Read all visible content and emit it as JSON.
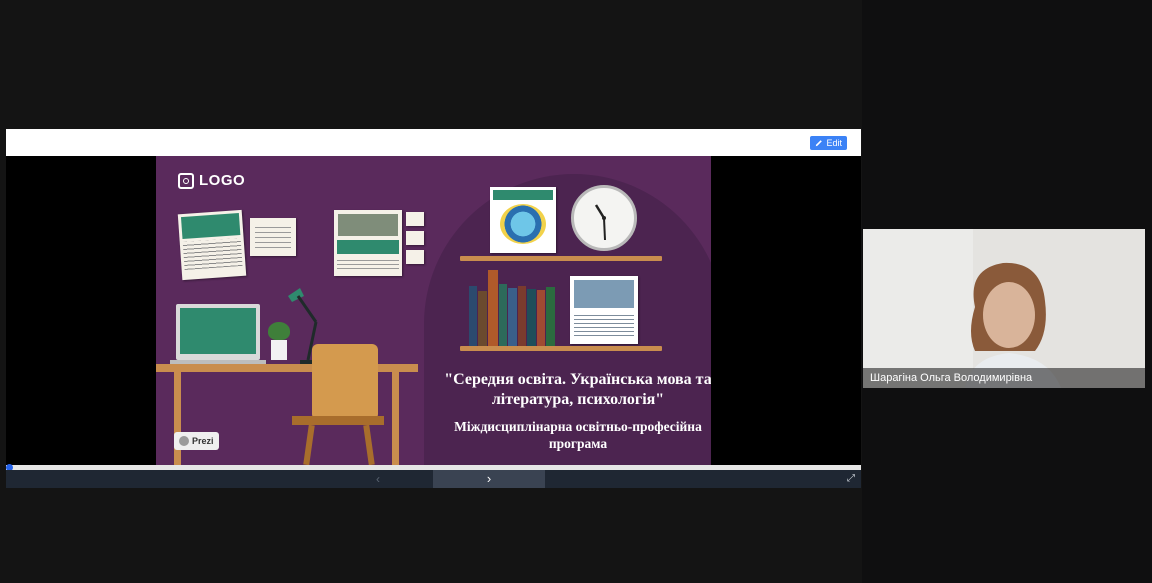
{
  "toolbar": {
    "edit_label": "Edit"
  },
  "slide": {
    "logo_text": "LOGO",
    "title": "\"Середня освіта. Українська мова та література, психологія\"",
    "subtitle": "Міждисциплінарна освітньо-професійна програма",
    "prezi_badge": "Prezi"
  },
  "navigation": {
    "prev_glyph": "‹",
    "next_glyph": "›",
    "progress": 0
  },
  "participant": {
    "name": "Шарагіна Ольга Володимирівна"
  },
  "colors": {
    "slide_bg": "#5a2a5c",
    "accent_green": "#2f8a6e",
    "shelf_wood": "#c98d4e",
    "edit_blue": "#3b82f6"
  }
}
